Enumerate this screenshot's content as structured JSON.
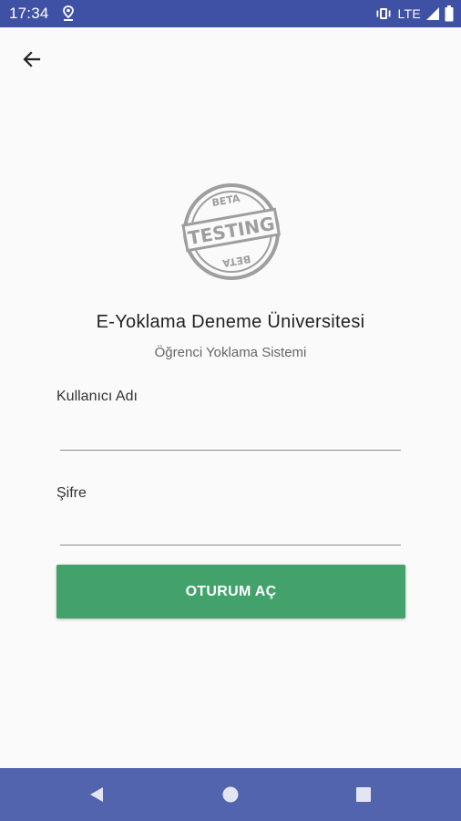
{
  "status_bar": {
    "time": "17:34",
    "network": "LTE",
    "background_color": "#3f51a5",
    "icons": [
      "location-notification-icon",
      "vibrate-icon",
      "signal-icon",
      "battery-icon"
    ]
  },
  "toolbar": {
    "back_icon": "arrow-left-icon"
  },
  "logo": {
    "stamp_main": "TESTING",
    "stamp_top": "BETA",
    "stamp_bottom": "BETA"
  },
  "header": {
    "title": "E-Yoklama Deneme Üniversitesi",
    "subtitle": "Öğrenci Yoklama Sistemi"
  },
  "form": {
    "username_label": "Kullanıcı Adı",
    "username_value": "",
    "password_label": "Şifre",
    "password_value": "",
    "submit_label": "OTURUM AÇ",
    "accent_color": "#43a16b"
  },
  "nav_bar": {
    "background_color": "#5264ae",
    "icons": [
      "back-triangle-icon",
      "home-circle-icon",
      "recents-square-icon"
    ]
  }
}
